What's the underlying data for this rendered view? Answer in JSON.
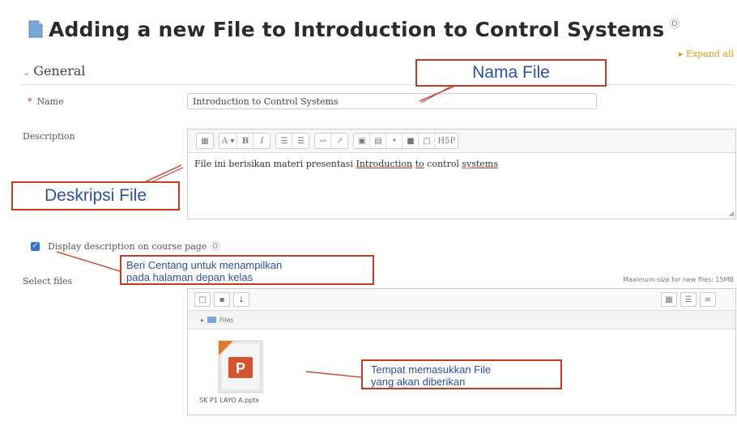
{
  "page": {
    "title": "Adding a new File to Introduction to Control Systems",
    "help_icon": "Ⓞ",
    "expand_all": "▸ Expand all"
  },
  "general": {
    "section_label": "General",
    "toggle_icon": "⌄"
  },
  "name": {
    "required_mark": "*",
    "label": "Name",
    "value": "Introduction to Control Systems"
  },
  "description": {
    "label": "Description",
    "text_parts": [
      "File ini berisikan materi presentasi ",
      "Introduction",
      " ",
      "to",
      " control ",
      "systems"
    ],
    "toolbar": [
      [
        "▦"
      ],
      [
        "A ▾",
        "B",
        "I"
      ],
      [
        "☰",
        "☰"
      ],
      [
        "↔",
        "↗"
      ],
      [
        "▣",
        "▤",
        "•",
        "■",
        "□",
        "H5P"
      ]
    ]
  },
  "display_description": {
    "label": "Display description on course page",
    "checked": true,
    "help_icon": "Ⓞ"
  },
  "select_files": {
    "label": "Select files",
    "max_size": "Maximum size for new files: 15MB",
    "path_label": "Files",
    "file_name": "SK P1 LAYO A.pptx",
    "file_icon_letter": "P"
  },
  "annotations": {
    "nama_file": "Nama File",
    "deskripsi_file": "Deskripsi File",
    "centang_line1": "Beri Centang untuk menampilkan",
    "centang_line2": "pada halaman depan kelas",
    "tempat_line1": "Tempat memasukkan File",
    "tempat_line2": "yang akan diberikan"
  },
  "colors": {
    "annotation_border": "#c23b22",
    "annotation_text": "#2c4fa8",
    "checkbox": "#3a73c4",
    "expand_link": "#d99a1c"
  }
}
